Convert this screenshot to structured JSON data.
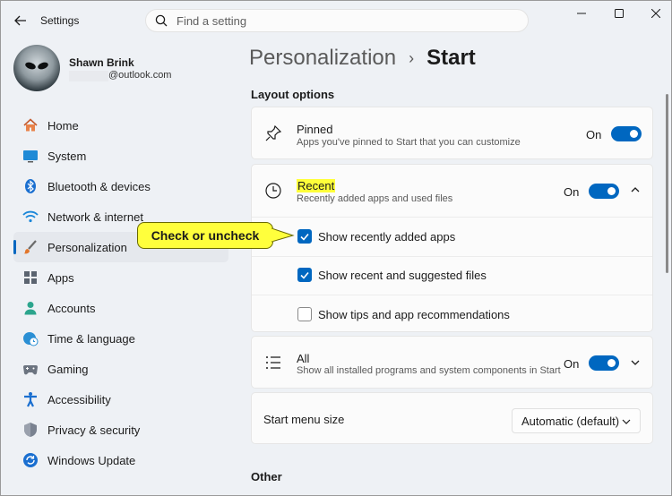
{
  "window": {
    "app_title": "Settings",
    "search_placeholder": "Find a setting"
  },
  "profile": {
    "name": "Shawn Brink",
    "email": "@outlook.com"
  },
  "sidebar": {
    "items": [
      {
        "label": "Home",
        "icon": "home-icon"
      },
      {
        "label": "System",
        "icon": "monitor-icon"
      },
      {
        "label": "Bluetooth & devices",
        "icon": "bluetooth-icon"
      },
      {
        "label": "Network & internet",
        "icon": "wifi-icon"
      },
      {
        "label": "Personalization",
        "icon": "brush-icon",
        "active": true
      },
      {
        "label": "Apps",
        "icon": "apps-icon"
      },
      {
        "label": "Accounts",
        "icon": "person-icon"
      },
      {
        "label": "Time & language",
        "icon": "globe-clock-icon"
      },
      {
        "label": "Gaming",
        "icon": "gamepad-icon"
      },
      {
        "label": "Accessibility",
        "icon": "accessibility-icon"
      },
      {
        "label": "Privacy & security",
        "icon": "shield-icon"
      },
      {
        "label": "Windows Update",
        "icon": "update-icon"
      }
    ]
  },
  "breadcrumb": {
    "parent": "Personalization",
    "separator": "›",
    "current": "Start"
  },
  "layout_options": {
    "heading": "Layout options",
    "pinned": {
      "title": "Pinned",
      "subtitle": "Apps you've pinned to Start that you can customize",
      "state": "On"
    },
    "recent": {
      "title": "Recent",
      "subtitle": "Recently added apps and used files",
      "state": "On",
      "options": [
        {
          "label": "Show recently added apps",
          "checked": true
        },
        {
          "label": "Show recent and suggested files",
          "checked": true
        },
        {
          "label": "Show tips and app recommendations",
          "checked": false
        }
      ]
    },
    "all": {
      "title": "All",
      "subtitle": "Show all installed programs and system components in Start",
      "state": "On"
    },
    "menu_size": {
      "label": "Start menu size",
      "value": "Automatic (default)"
    }
  },
  "other": {
    "heading": "Other"
  },
  "callout": {
    "text": "Check or uncheck"
  },
  "colors": {
    "accent": "#0067c0",
    "callout": "#ffff3c",
    "highlight": "#ffff3a"
  }
}
